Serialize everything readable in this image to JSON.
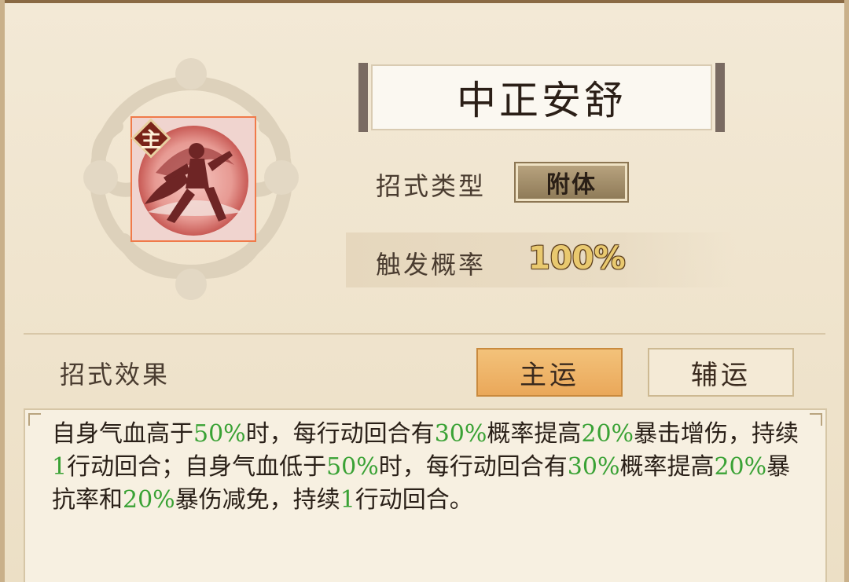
{
  "skill": {
    "name": "中正安舒",
    "badge": "主",
    "type_label": "招式类型",
    "type_value": "附体",
    "trigger_label": "触发概率",
    "trigger_value": "100%"
  },
  "effect": {
    "label": "招式效果",
    "tabs": [
      {
        "label": "主运",
        "active": true
      },
      {
        "label": "辅运",
        "active": false
      }
    ],
    "description": [
      {
        "t": "自身气血高于"
      },
      {
        "t": "50%",
        "g": true
      },
      {
        "t": "时，每行动回合有"
      },
      {
        "t": "30%",
        "g": true
      },
      {
        "t": "概率提高"
      },
      {
        "t": "20%",
        "g": true
      },
      {
        "t": "暴击增伤，持续"
      },
      {
        "t": "1",
        "g": true
      },
      {
        "t": "行动回合；自身气血低于"
      },
      {
        "t": "50%",
        "g": true
      },
      {
        "t": "时，每行动回合有"
      },
      {
        "t": "30%",
        "g": true
      },
      {
        "t": "概率提高"
      },
      {
        "t": "20%",
        "g": true
      },
      {
        "t": "暴抗率和"
      },
      {
        "t": "20%",
        "g": true
      },
      {
        "t": "暴伤减免，持续"
      },
      {
        "t": "1",
        "g": true
      },
      {
        "t": "行动回合。"
      }
    ]
  },
  "colors": {
    "highlight": "#3aa235",
    "active_tab": "#eaa85a",
    "icon_bg": "#e43c2a"
  },
  "icons": [
    "cloud-emblem",
    "fighter-silhouette-icon",
    "main-badge-icon"
  ]
}
